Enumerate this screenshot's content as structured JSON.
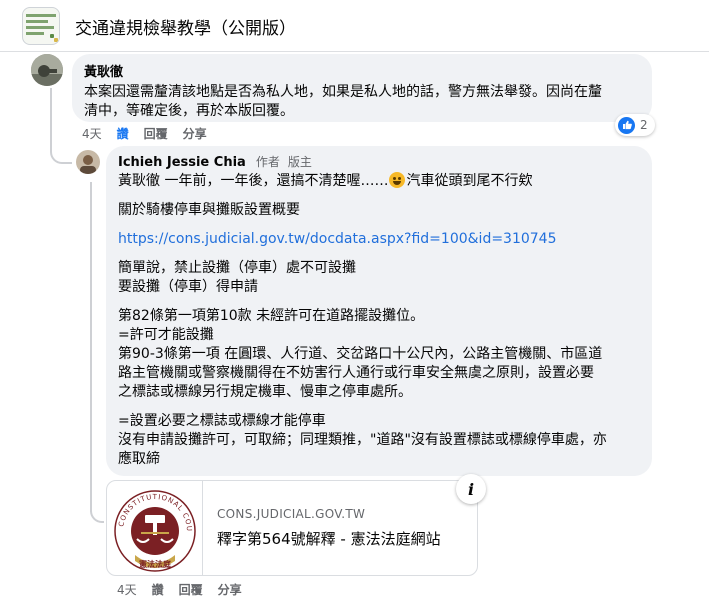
{
  "group": {
    "title": "交通違規檢舉教學（公開版）"
  },
  "comment": {
    "author": "黃耿徹",
    "text_lines": [
      "本案因還需釐清該地點是否為私人地，如果是私人地的話，警方無法舉發。因尚在釐",
      "清中，等確定後，再於本版回覆。"
    ],
    "time": "4天",
    "like_label": "讚",
    "reply_label": "回覆",
    "share_label": "分享",
    "reaction_count": "2"
  },
  "reply": {
    "author": "Ichieh Jessie Chia",
    "role_author": "作者",
    "role_admin": "版主",
    "mention": "黃耿徹",
    "line1_after_mention": " 一年前，一年後，還搞不清楚喔……",
    "line1_after_emoji": "汽車從頭到尾不行欸",
    "para2": "關於騎樓停車與攤販設置概要",
    "link": "https://cons.judicial.gov.tw/docdata.aspx?fid=100&id=310745",
    "para3": [
      "簡單說，禁止設攤（停車）處不可設攤",
      "要設攤（停車）得申請"
    ],
    "para4": [
      "第82條第一項第10款 未經許可在道路擺設攤位。",
      "=許可才能設攤",
      "第90-3條第一項 在圓環、人行道、交岔路口十公尺內，公路主管機關、市區道",
      "路主管機關或警察機關得在不妨害行人通行或行車安全無虞之原則，設置必要",
      "之標誌或標線另行規定機車、慢車之停車處所。"
    ],
    "para5": [
      "=設置必要之標誌或標線才能停車",
      "沒有申請設攤許可，可取締；同理類推，\"道路\"沒有設置標誌或標線停車處，亦",
      "應取締"
    ],
    "time": "4天",
    "like_label": "讚",
    "reply_label": "回覆",
    "share_label": "分享"
  },
  "link_card": {
    "domain": "CONS.JUDICIAL.GOV.TW",
    "title": "釋字第564號解釋 - 憲法法庭網站",
    "seal_text_top": "CONSTITUTIONAL COURT",
    "seal_text_bottom": "憲法法庭",
    "info_label": "i"
  },
  "icons": [
    "group-icon",
    "avatar",
    "like-icon",
    "info-icon",
    "court-seal-logo"
  ],
  "colors": {
    "link": "#216fdb",
    "bubble": "#f0f2f5",
    "like": "#1877f2",
    "seal": "#7b2024",
    "gold": "#c9a64a"
  }
}
